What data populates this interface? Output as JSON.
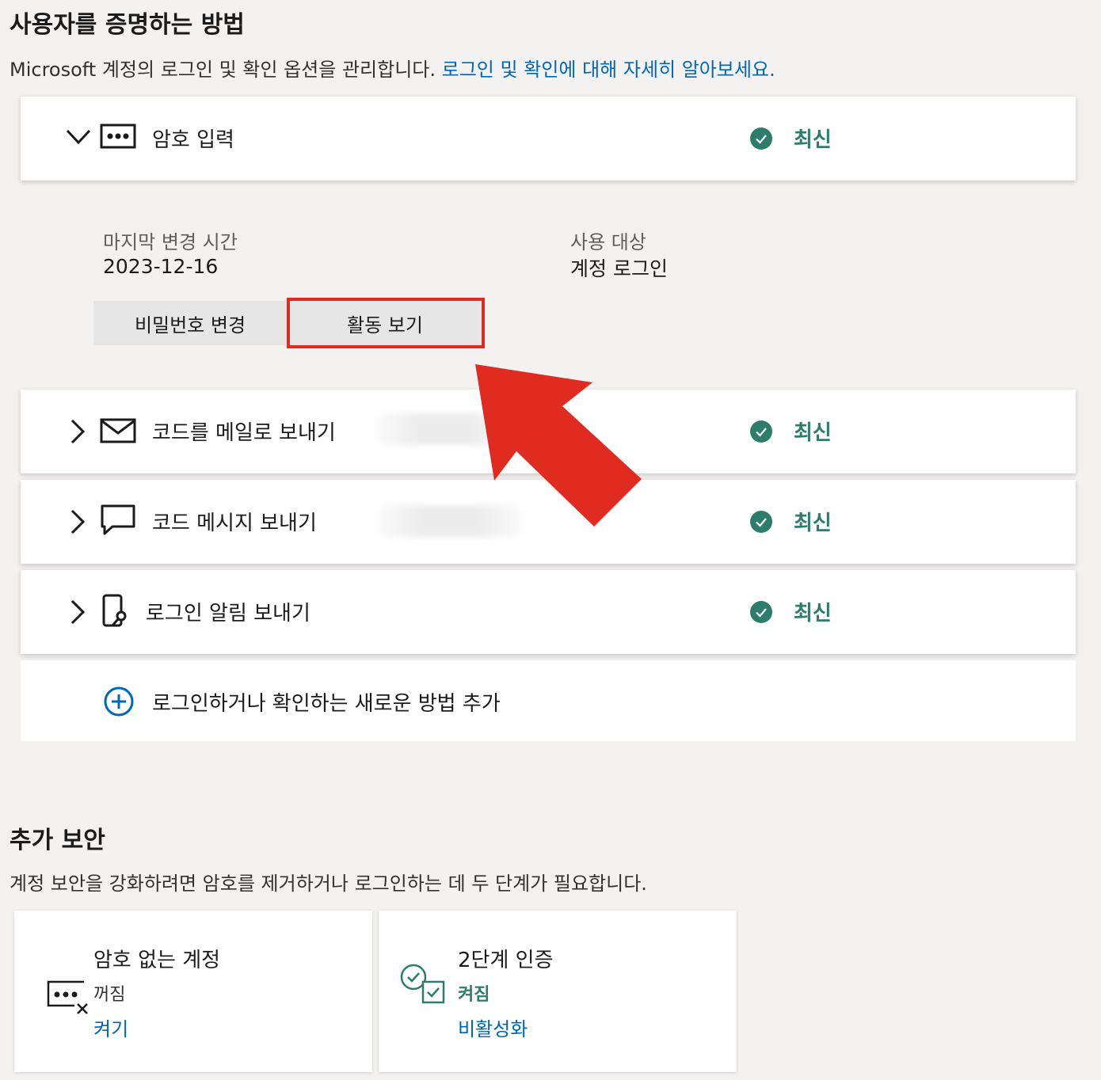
{
  "header": {
    "title": "사용자를 증명하는 방법",
    "description": "Microsoft 계정의 로그인 및 확인 옵션을 관리합니다.",
    "learn_more_link": "로그인 및 확인에 대해 자세히 알아보세요."
  },
  "methods": [
    {
      "label": "암호 입력",
      "status": "최신",
      "icon": "password-dots-icon",
      "expanded": true
    },
    {
      "label": "코드를 메일로 보내기",
      "status": "최신",
      "icon": "mail-icon",
      "expanded": false
    },
    {
      "label": "코드 메시지 보내기",
      "status": "최신",
      "icon": "chat-bubble-icon",
      "expanded": false
    },
    {
      "label": "로그인 알림 보내기",
      "status": "최신",
      "icon": "phone-key-icon",
      "expanded": false
    }
  ],
  "password_details": {
    "last_changed_label": "마지막 변경 시간",
    "last_changed_value": "2023-12-16",
    "used_for_label": "사용 대상",
    "used_for_value": "계정 로그인",
    "change_password_button": "비밀번호 변경",
    "view_activity_button": "활동 보기"
  },
  "add_method_link": "로그인하거나 확인하는 새로운 방법 추가",
  "additional_security": {
    "title": "추가 보안",
    "description": "계정 보안을 강화하려면 암호를 제거하거나 로그인하는 데 두 단계가 필요합니다.",
    "cards": [
      {
        "title": "암호 없는 계정",
        "state": "꺼짐",
        "action": "켜기",
        "icon": "password-off-icon"
      },
      {
        "title": "2단계 인증",
        "state": "켜짐",
        "action": "비활성화",
        "icon": "two-step-verification-icon"
      }
    ]
  },
  "colors": {
    "accent": "#0067b8",
    "status_green": "#2e7d6b",
    "highlight_red": "#e02b20",
    "background": "#f3f2f1"
  }
}
